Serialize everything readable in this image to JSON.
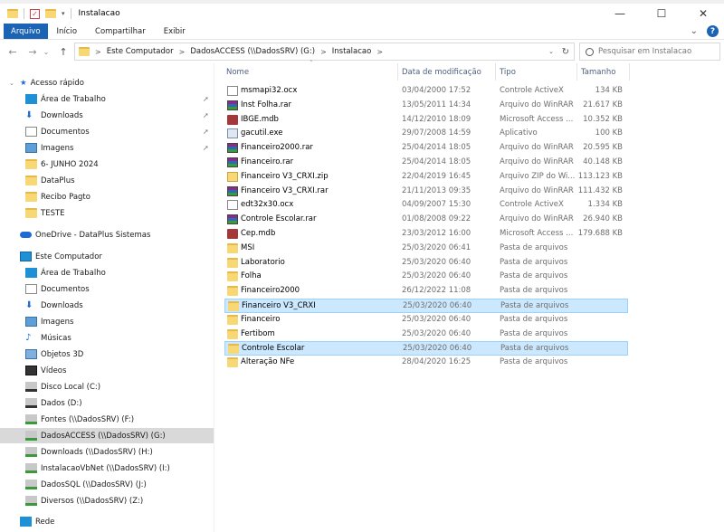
{
  "window": {
    "title": "Instalacao",
    "buttons": {
      "minimize": "—",
      "maximize": "☐",
      "close": "✕"
    }
  },
  "ribbon": {
    "tabs": [
      {
        "label": "Arquivo"
      },
      {
        "label": "Início"
      },
      {
        "label": "Compartilhar"
      },
      {
        "label": "Exibir"
      }
    ],
    "expand_glyph": "⌄",
    "help_glyph": "?"
  },
  "nav": {
    "back": "←",
    "forward": "→",
    "recent": "⌄",
    "up": "↑"
  },
  "address": {
    "crumbs": [
      "Este Computador",
      "DadosACCESS (\\\\DadosSRV) (G:)",
      "Instalacao"
    ],
    "separator": ">",
    "dropdown": "⌄",
    "refresh": "↻"
  },
  "search": {
    "placeholder": "Pesquisar em Instalacao",
    "icon": "search-icon"
  },
  "columns": {
    "name": "Nome",
    "date": "Data de modificação",
    "type": "Tipo",
    "size": "Tamanho"
  },
  "sidebar": {
    "items": [
      {
        "label": "Acesso rápido",
        "icon": "star-icon",
        "pinned": false
      },
      {
        "label": "Área de Trabalho",
        "icon": "desktop-icon",
        "pinned": true
      },
      {
        "label": "Downloads",
        "icon": "download-icon",
        "pinned": true
      },
      {
        "label": "Documentos",
        "icon": "documents-icon",
        "pinned": true
      },
      {
        "label": "Imagens",
        "icon": "pictures-icon",
        "pinned": true
      },
      {
        "label": "6- JUNHO 2024",
        "icon": "folder-icon",
        "pinned": false
      },
      {
        "label": "DataPlus",
        "icon": "folder-icon",
        "pinned": false
      },
      {
        "label": "Recibo Pagto",
        "icon": "folder-icon",
        "pinned": false
      },
      {
        "label": "TESTE",
        "icon": "folder-icon",
        "pinned": false
      },
      {
        "label": "OneDrive - DataPlus Sistemas",
        "icon": "onedrive-icon",
        "pinned": false
      },
      {
        "label": "Este Computador",
        "icon": "computer-icon",
        "pinned": false
      },
      {
        "label": "Área de Trabalho",
        "icon": "desktop-icon",
        "pinned": false
      },
      {
        "label": "Documentos",
        "icon": "documents-icon",
        "pinned": false
      },
      {
        "label": "Downloads",
        "icon": "download-icon",
        "pinned": false
      },
      {
        "label": "Imagens",
        "icon": "pictures-icon",
        "pinned": false
      },
      {
        "label": "Músicas",
        "icon": "music-icon",
        "pinned": false
      },
      {
        "label": "Objetos 3D",
        "icon": "objects-3d-icon",
        "pinned": false
      },
      {
        "label": "Vídeos",
        "icon": "videos-icon",
        "pinned": false
      },
      {
        "label": "Disco Local (C:)",
        "icon": "drive-icon",
        "pinned": false
      },
      {
        "label": "Dados (D:)",
        "icon": "drive-icon",
        "pinned": false
      },
      {
        "label": "Fontes (\\\\DadosSRV) (F:)",
        "icon": "network-drive-icon",
        "pinned": false
      },
      {
        "label": "DadosACCESS (\\\\DadosSRV) (G:)",
        "icon": "network-drive-icon",
        "pinned": false,
        "selected": true
      },
      {
        "label": "Downloads (\\\\DadosSRV) (H:)",
        "icon": "network-drive-icon",
        "pinned": false
      },
      {
        "label": "InstalacaoVbNet (\\\\DadosSRV) (I:)",
        "icon": "network-drive-icon",
        "pinned": false
      },
      {
        "label": "DadosSQL (\\\\DadosSRV) (J:)",
        "icon": "network-drive-icon",
        "pinned": false
      },
      {
        "label": "Diversos (\\\\DadosSRV) (Z:)",
        "icon": "network-drive-icon",
        "pinned": false
      },
      {
        "label": "Rede",
        "icon": "network-icon",
        "pinned": false
      }
    ],
    "pin_glyph": "📌"
  },
  "files": [
    {
      "name": "msmapi32.ocx",
      "date": "03/04/2000 17:52",
      "type": "Controle ActiveX",
      "size": "134 KB",
      "icon": "file-icon"
    },
    {
      "name": "Inst Folha.rar",
      "date": "13/05/2011 14:34",
      "type": "Arquivo do WinRAR",
      "size": "21.617 KB",
      "icon": "rar-icon"
    },
    {
      "name": "IBGE.mdb",
      "date": "14/12/2010 18:09",
      "type": "Microsoft Access ...",
      "size": "10.352 KB",
      "icon": "access-icon"
    },
    {
      "name": "gacutil.exe",
      "date": "29/07/2008 14:59",
      "type": "Aplicativo",
      "size": "100 KB",
      "icon": "exe-icon"
    },
    {
      "name": "Financeiro2000.rar",
      "date": "25/04/2014 18:05",
      "type": "Arquivo do WinRAR",
      "size": "20.595 KB",
      "icon": "rar-icon"
    },
    {
      "name": "Financeiro.rar",
      "date": "25/04/2014 18:05",
      "type": "Arquivo do WinRAR",
      "size": "40.148 KB",
      "icon": "rar-icon"
    },
    {
      "name": "Financeiro V3_CRXI.zip",
      "date": "22/04/2019 16:45",
      "type": "Arquivo ZIP do Wi...",
      "size": "113.123 KB",
      "icon": "zip-icon"
    },
    {
      "name": "Financeiro V3_CRXI.rar",
      "date": "21/11/2013 09:35",
      "type": "Arquivo do WinRAR",
      "size": "111.432 KB",
      "icon": "rar-icon"
    },
    {
      "name": "edt32x30.ocx",
      "date": "04/09/2007 15:30",
      "type": "Controle ActiveX",
      "size": "1.334 KB",
      "icon": "file-icon"
    },
    {
      "name": "Controle Escolar.rar",
      "date": "01/08/2008 09:22",
      "type": "Arquivo do WinRAR",
      "size": "26.940 KB",
      "icon": "rar-icon"
    },
    {
      "name": "Cep.mdb",
      "date": "23/03/2012 16:00",
      "type": "Microsoft Access ...",
      "size": "179.688 KB",
      "icon": "access-icon"
    },
    {
      "name": "MSI",
      "date": "25/03/2020 06:41",
      "type": "Pasta de arquivos",
      "size": "",
      "icon": "folder-icon"
    },
    {
      "name": "Laboratorio",
      "date": "25/03/2020 06:40",
      "type": "Pasta de arquivos",
      "size": "",
      "icon": "folder-icon"
    },
    {
      "name": "Folha",
      "date": "25/03/2020 06:40",
      "type": "Pasta de arquivos",
      "size": "",
      "icon": "folder-icon"
    },
    {
      "name": "Financeiro2000",
      "date": "26/12/2022 11:08",
      "type": "Pasta de arquivos",
      "size": "",
      "icon": "folder-icon"
    },
    {
      "name": "Financeiro V3_CRXI",
      "date": "25/03/2020 06:40",
      "type": "Pasta de arquivos",
      "size": "",
      "icon": "folder-icon",
      "state": "selected"
    },
    {
      "name": "Financeiro",
      "date": "25/03/2020 06:40",
      "type": "Pasta de arquivos",
      "size": "",
      "icon": "folder-icon"
    },
    {
      "name": "Fertibom",
      "date": "25/03/2020 06:40",
      "type": "Pasta de arquivos",
      "size": "",
      "icon": "folder-icon"
    },
    {
      "name": "Controle Escolar",
      "date": "25/03/2020 06:40",
      "type": "Pasta de arquivos",
      "size": "",
      "icon": "folder-icon",
      "state": "selected"
    },
    {
      "name": "Alteração NFe",
      "date": "28/04/2020 16:25",
      "type": "Pasta de arquivos",
      "size": "",
      "icon": "folder-icon"
    }
  ],
  "colors": {
    "accent": "#1a63b5",
    "selection": "#cce8ff",
    "selection_border": "#99d1ff",
    "sidebar_selected": "#d9d9d9"
  }
}
